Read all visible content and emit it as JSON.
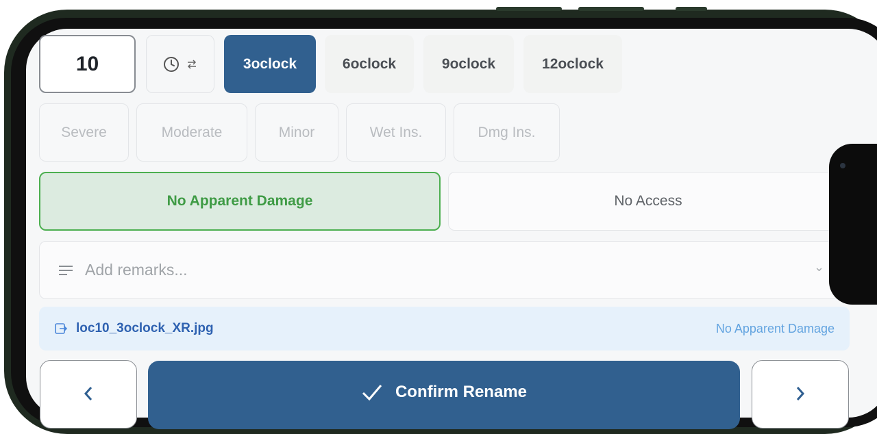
{
  "location": {
    "number": "10"
  },
  "rotate": {
    "icon": "clock-swap-icon"
  },
  "clock_positions": [
    {
      "label": "3oclock",
      "active": true
    },
    {
      "label": "6oclock",
      "active": false
    },
    {
      "label": "9oclock",
      "active": false
    },
    {
      "label": "12oclock",
      "active": false
    }
  ],
  "severity": [
    "Severe",
    "Moderate",
    "Minor",
    "Wet Ins.",
    "Dmg Ins."
  ],
  "status_options": {
    "no_damage": "No Apparent Damage",
    "no_access": "No Access"
  },
  "remarks": {
    "placeholder": "Add remarks..."
  },
  "file": {
    "name": "loc10_3oclock_XR.jpg",
    "status": "No Apparent Damage"
  },
  "actions": {
    "prev_icon": "chevron-left-icon",
    "confirm": "Confirm Rename",
    "next_icon": "chevron-right-icon"
  },
  "colors": {
    "primary": "#31608f",
    "success": "#4caf50",
    "success_bg": "#dcebe0",
    "file_bg": "#e6f1fb"
  }
}
